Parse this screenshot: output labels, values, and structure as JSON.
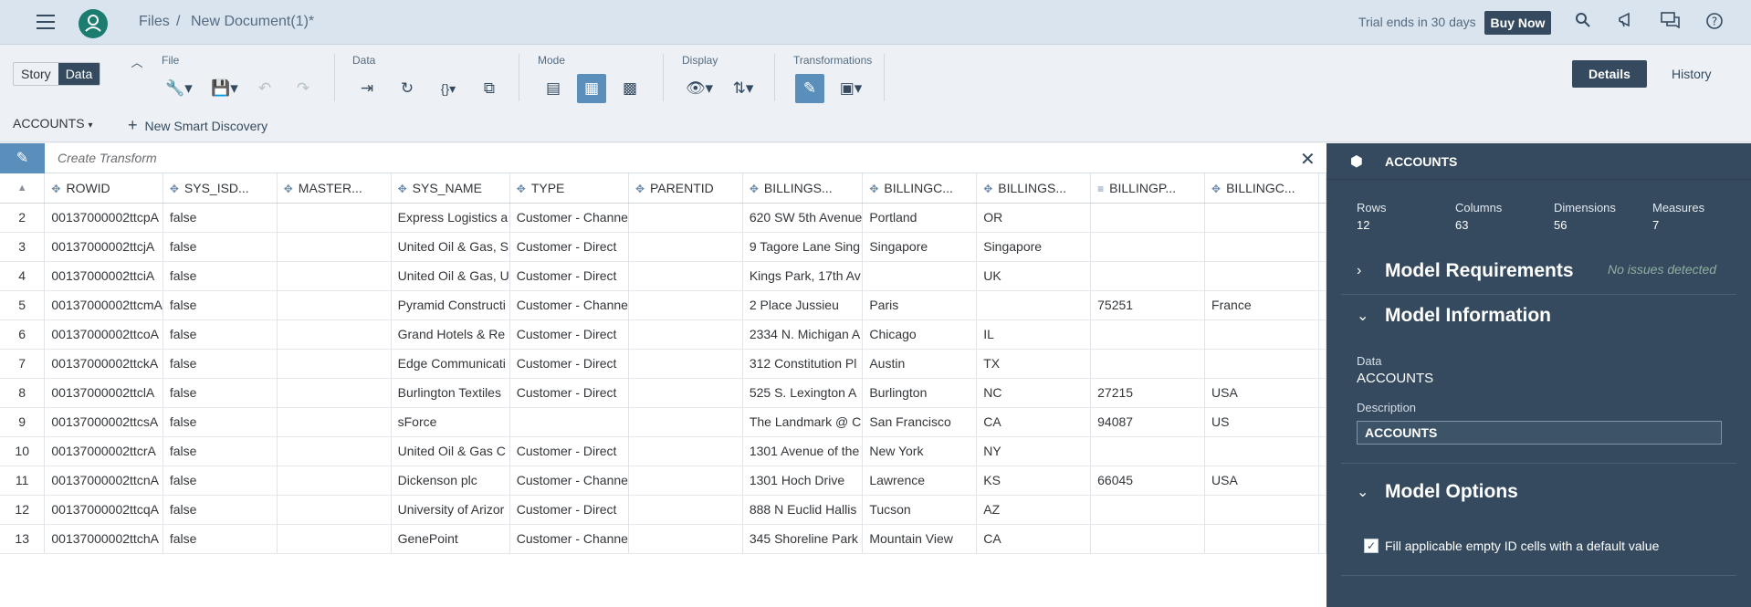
{
  "shell": {
    "files": "Files",
    "separator": "/",
    "document": "New Document(1)*",
    "trial": "Trial ends in 30 days",
    "buy_now": "Buy Now"
  },
  "toolbar": {
    "story": "Story",
    "data": "Data",
    "groups": {
      "file": "File",
      "data": "Data",
      "mode": "Mode",
      "display": "Display",
      "transformations": "Transformations"
    },
    "details": "Details",
    "history": "History",
    "dataset": "ACCOUNTS",
    "new_smart": "New Smart Discovery"
  },
  "transform": {
    "placeholder": "Create Transform"
  },
  "table": {
    "columns": [
      "ROWID",
      "SYS_ISD...",
      "MASTER...",
      "SYS_NAME",
      "TYPE",
      "PARENTID",
      "BILLINGS...",
      "BILLINGC...",
      "BILLINGS...",
      "BILLINGP...",
      "BILLINGC..."
    ],
    "rows": [
      {
        "n": "2",
        "cells": [
          "00137000002ttcpA",
          "false",
          "",
          "Express Logistics a",
          "Customer - Channe",
          "",
          "620 SW 5th Avenue",
          "Portland",
          "OR",
          "",
          ""
        ]
      },
      {
        "n": "3",
        "cells": [
          "00137000002ttcjA",
          "false",
          "",
          "United Oil & Gas, S",
          "Customer - Direct",
          "",
          "9 Tagore Lane Sing",
          "Singapore",
          "Singapore",
          "",
          ""
        ]
      },
      {
        "n": "4",
        "cells": [
          "00137000002ttciA",
          "false",
          "",
          "United Oil & Gas, U",
          "Customer - Direct",
          "",
          "Kings Park, 17th Av",
          "",
          "UK",
          "",
          ""
        ]
      },
      {
        "n": "5",
        "cells": [
          "00137000002ttcmA",
          "false",
          "",
          "Pyramid Constructi",
          "Customer - Channe",
          "",
          "2 Place Jussieu",
          "Paris",
          "",
          "75251",
          "France"
        ]
      },
      {
        "n": "6",
        "cells": [
          "00137000002ttcoA",
          "false",
          "",
          "Grand Hotels & Re",
          "Customer - Direct",
          "",
          "2334 N. Michigan A",
          "Chicago",
          "IL",
          "",
          ""
        ]
      },
      {
        "n": "7",
        "cells": [
          "00137000002ttckA",
          "false",
          "",
          "Edge Communicati",
          "Customer - Direct",
          "",
          "312 Constitution Pl",
          "Austin",
          "TX",
          "",
          ""
        ]
      },
      {
        "n": "8",
        "cells": [
          "00137000002ttclA",
          "false",
          "",
          "Burlington Textiles",
          "Customer - Direct",
          "",
          "525 S. Lexington A",
          "Burlington",
          "NC",
          "27215",
          "USA"
        ]
      },
      {
        "n": "9",
        "cells": [
          "00137000002ttcsA",
          "false",
          "",
          "sForce",
          "",
          "",
          "The Landmark @ C",
          "San Francisco",
          "CA",
          "94087",
          "US"
        ]
      },
      {
        "n": "10",
        "cells": [
          "00137000002ttcrA",
          "false",
          "",
          "United Oil & Gas C",
          "Customer - Direct",
          "",
          "1301 Avenue of the",
          "New York",
          "NY",
          "",
          ""
        ]
      },
      {
        "n": "11",
        "cells": [
          "00137000002ttcnA",
          "false",
          "",
          "Dickenson plc",
          "Customer - Channe",
          "",
          "1301 Hoch Drive",
          "Lawrence",
          "KS",
          "66045",
          "USA"
        ]
      },
      {
        "n": "12",
        "cells": [
          "00137000002ttcqA",
          "false",
          "",
          "University of Arizor",
          "Customer - Direct",
          "",
          "888 N Euclid Hallis",
          "Tucson",
          "AZ",
          "",
          ""
        ]
      },
      {
        "n": "13",
        "cells": [
          "00137000002ttchA",
          "false",
          "",
          "GenePoint",
          "Customer - Channe",
          "",
          "345 Shoreline Park",
          "Mountain View",
          "CA",
          "",
          ""
        ]
      }
    ]
  },
  "panel": {
    "title": "ACCOUNTS",
    "stats": [
      {
        "label": "Rows",
        "value": "12"
      },
      {
        "label": "Columns",
        "value": "63"
      },
      {
        "label": "Dimensions",
        "value": "56"
      },
      {
        "label": "Measures",
        "value": "7"
      }
    ],
    "requirements": "Model Requirements",
    "no_issues": "No issues detected",
    "information": "Model Information",
    "data_label": "Data",
    "data_value": "ACCOUNTS",
    "desc_label": "Description",
    "desc_value": "ACCOUNTS",
    "options": "Model Options",
    "fill_option": "Fill applicable empty ID cells with a default value"
  },
  "colors": {
    "shell": "#d9e4ee",
    "brand": "#354a5f",
    "accent": "#5b8fbb",
    "avatar": "#1d7c70"
  }
}
